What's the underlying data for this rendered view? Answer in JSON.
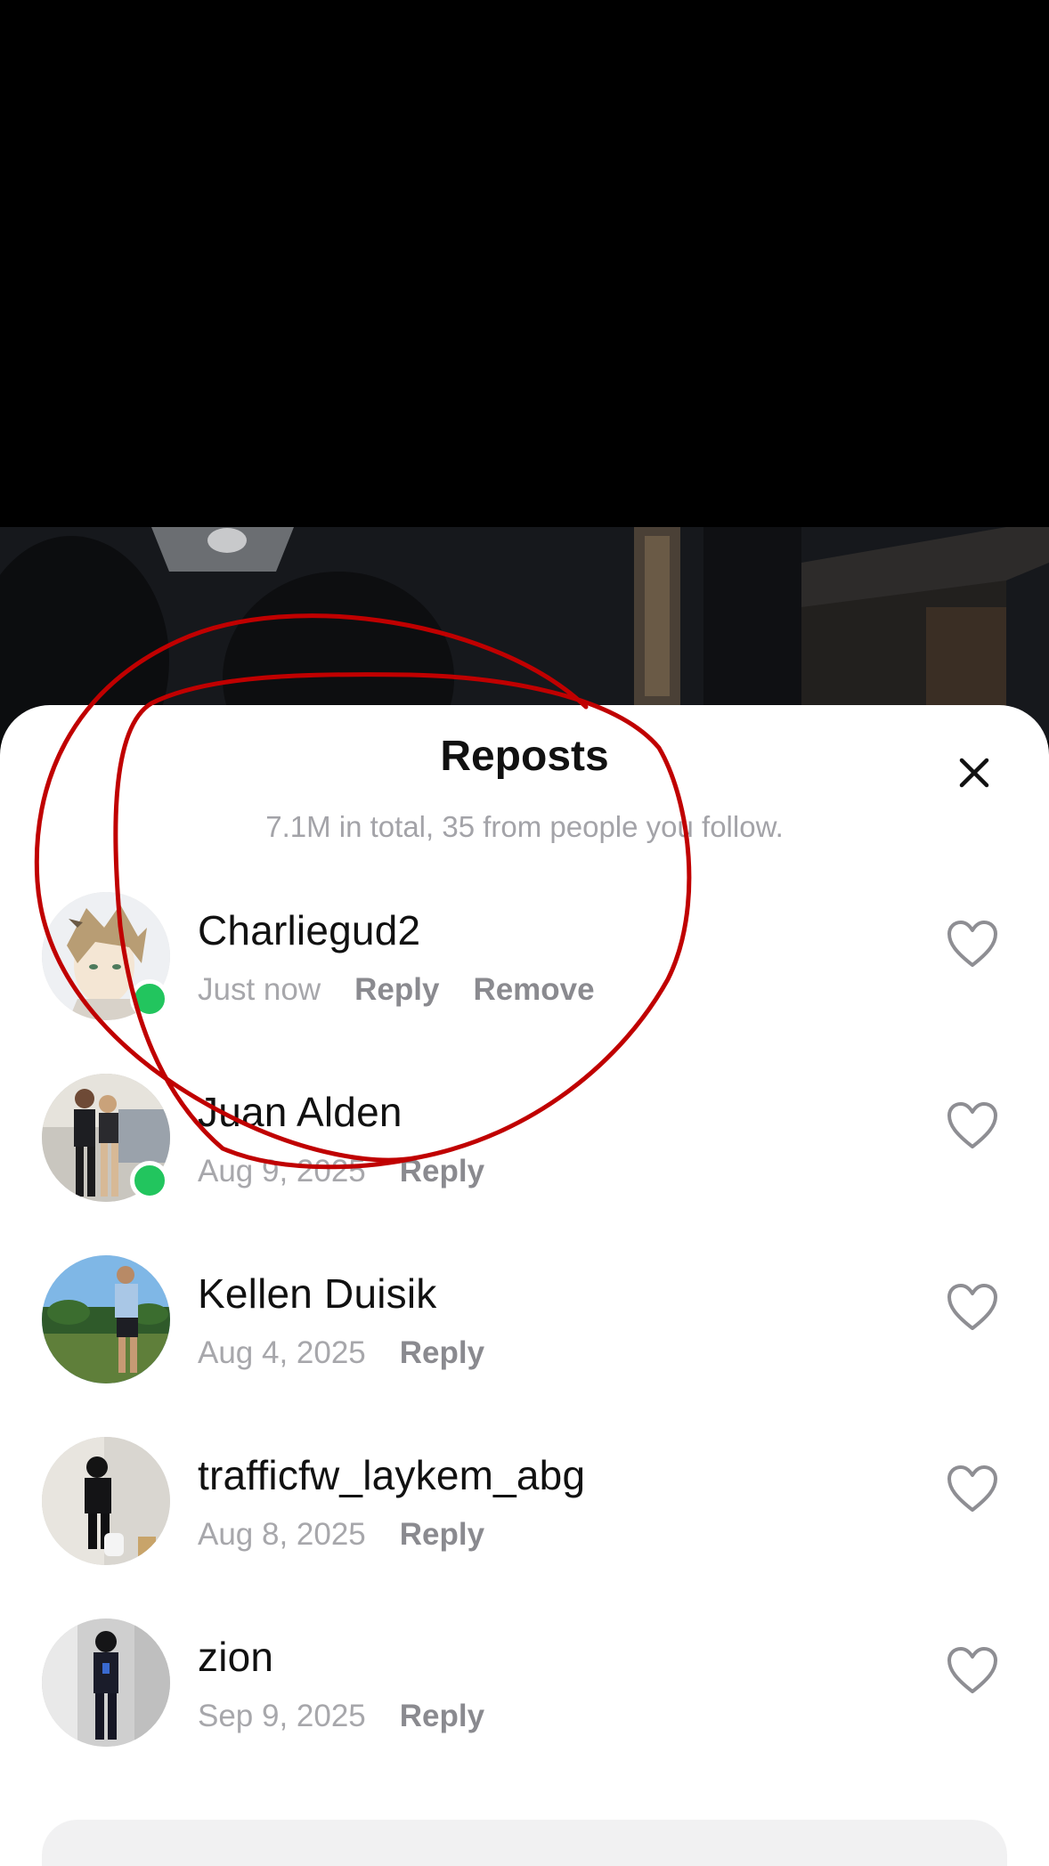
{
  "sheet": {
    "title": "Reposts",
    "subtitle": "7.1M in total, 35 from people you follow."
  },
  "reposts": [
    {
      "name": "Charliegud2",
      "time": "Just now",
      "reply_label": "Reply",
      "remove_label": "Remove",
      "online": true
    },
    {
      "name": "Juan Alden",
      "time": "Aug 9, 2025",
      "reply_label": "Reply",
      "online": true
    },
    {
      "name": "Kellen Duisik",
      "time": "Aug 4, 2025",
      "reply_label": "Reply",
      "online": false
    },
    {
      "name": "trafficfw_laykem_abg",
      "time": "Aug 8, 2025",
      "reply_label": "Reply",
      "online": false
    },
    {
      "name": "zion",
      "time": "Sep 9, 2025",
      "reply_label": "Reply",
      "online": false
    }
  ],
  "icons": {
    "close": "close-icon",
    "like": "heart-icon"
  },
  "colors": {
    "online": "#22c55e",
    "annotation": "#c00000",
    "muted_text": "#a7a7ab",
    "action_text": "#8a8a8f"
  }
}
